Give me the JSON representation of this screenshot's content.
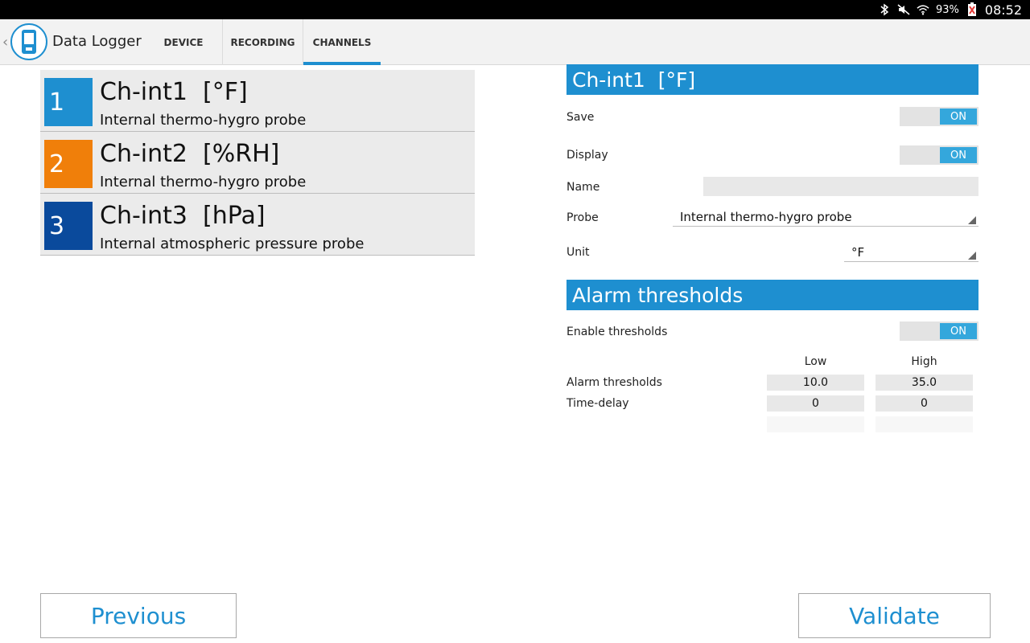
{
  "status_bar": {
    "battery": "93%",
    "time": "08:52",
    "icons": [
      "bluetooth-icon",
      "mute-icon",
      "wifi-icon",
      "battery-icon"
    ]
  },
  "action_bar": {
    "title": "Data Logger",
    "tabs": [
      {
        "label": "DEVICE",
        "active": false
      },
      {
        "label": "RECORDING",
        "active": false
      },
      {
        "label": "CHANNELS",
        "active": true
      }
    ]
  },
  "channels": [
    {
      "number": "1",
      "name": "Ch-int1  [°F]",
      "probe": "Internal thermo-hygro probe",
      "color": "#1e8fd0"
    },
    {
      "number": "2",
      "name": "Ch-int2  [%RH]",
      "probe": "Internal thermo-hygro probe",
      "color": "#f07f0a"
    },
    {
      "number": "3",
      "name": "Ch-int3  [hPa]",
      "probe": "Internal atmospheric pressure probe",
      "color": "#0a4a9c"
    }
  ],
  "settings": {
    "header": "Ch-int1  [°F]",
    "save_label": "Save",
    "save_toggle": "ON",
    "display_label": "Display",
    "display_toggle": "ON",
    "name_label": "Name",
    "name_value": "",
    "probe_label": "Probe",
    "probe_value": "Internal thermo-hygro probe",
    "unit_label": "Unit",
    "unit_value": "°F"
  },
  "alarm": {
    "header": "Alarm thresholds",
    "enable_label": "Enable thresholds",
    "enable_toggle": "ON",
    "low_label": "Low",
    "high_label": "High",
    "thresholds_label": "Alarm thresholds",
    "thresholds_low": "10.0",
    "thresholds_high": "35.0",
    "delay_label": "Time-delay",
    "delay_low": "0",
    "delay_high": "0"
  },
  "buttons": {
    "previous": "Previous",
    "validate": "Validate"
  },
  "colors": {
    "accent": "#1e8fd0",
    "toggle_on": "#34a7dc",
    "channel_1": "#1e8fd0",
    "channel_2": "#f07f0a",
    "channel_3": "#0a4a9c"
  }
}
